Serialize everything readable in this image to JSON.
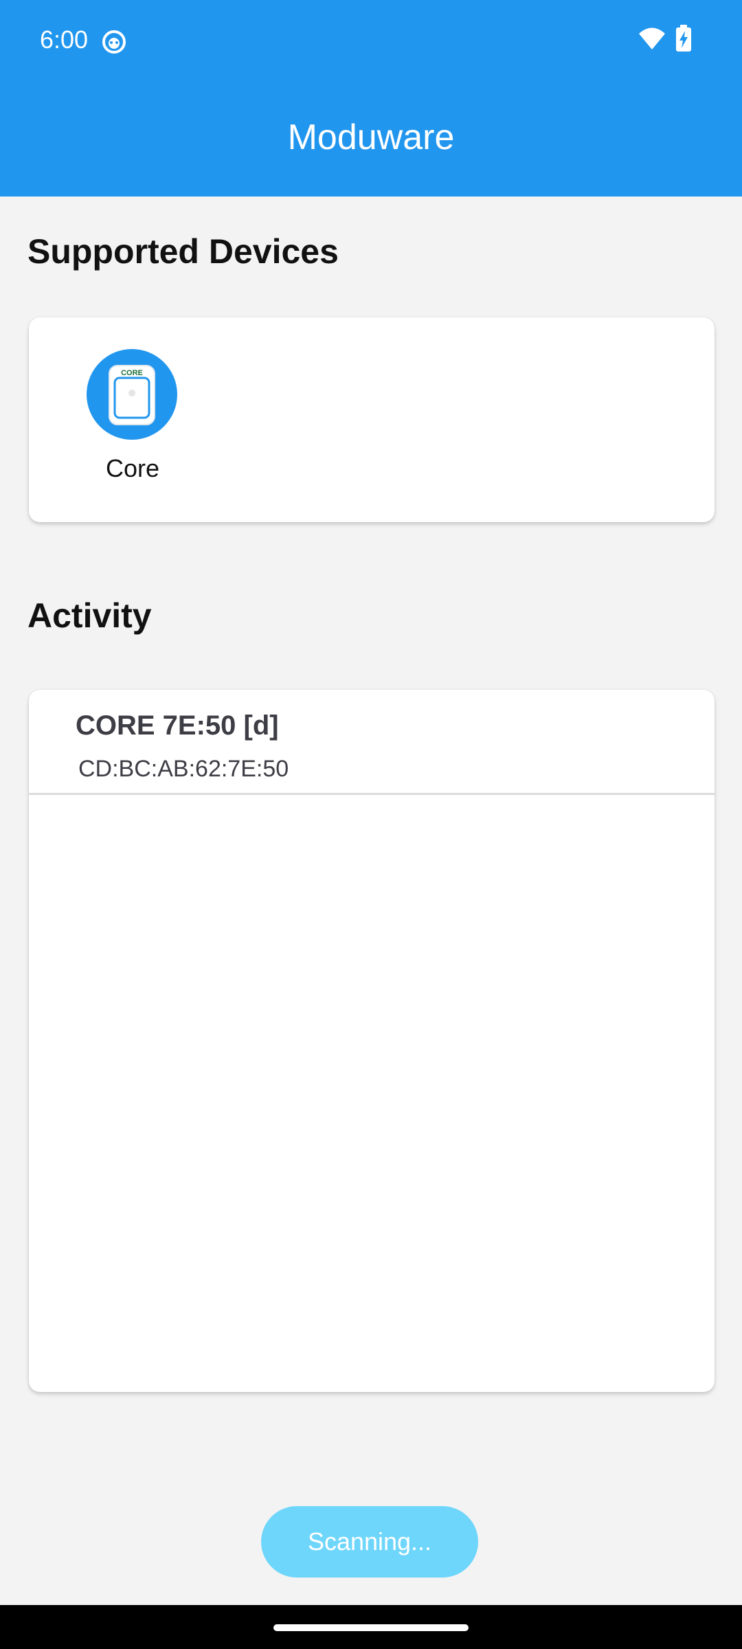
{
  "status_bar": {
    "time": "6:00",
    "icons": [
      "face-icon",
      "wifi-icon",
      "battery-charging-icon"
    ]
  },
  "app_bar": {
    "title": "Moduware",
    "color": "#2196ee"
  },
  "supported_devices": {
    "heading": "Supported Devices",
    "items": [
      {
        "label": "Core",
        "icon": "core-device-icon",
        "icon_text": "CORE"
      }
    ]
  },
  "activity": {
    "heading": "Activity",
    "items": [
      {
        "name": "CORE 7E:50 [d]",
        "address": "CD:BC:AB:62:7E:50"
      }
    ]
  },
  "scan_button": {
    "label": "Scanning...",
    "color": "#6fd6fb"
  }
}
